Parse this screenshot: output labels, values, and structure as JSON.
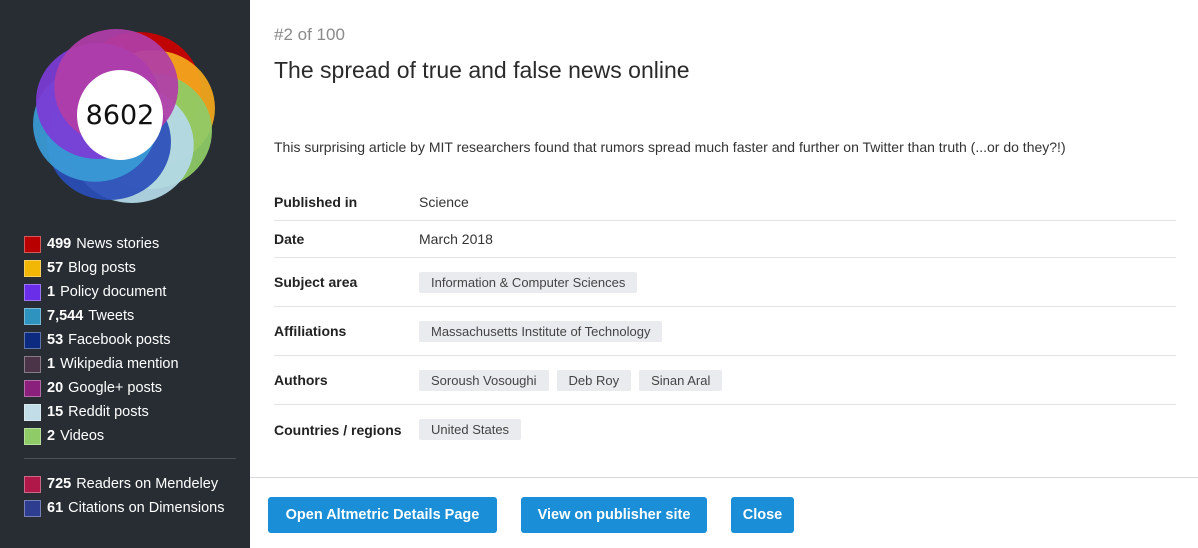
{
  "score": "8602",
  "donut_colors": [
    "#cc0000",
    "#f4a81c",
    "#8fcb67",
    "#b5d9e8",
    "#2a4db8",
    "#3a9bd6",
    "#7c3bd6",
    "#b03da8"
  ],
  "legend": {
    "items": [
      {
        "count": "499",
        "label": "News stories",
        "color": "#b80000"
      },
      {
        "count": "57",
        "label": "Blog posts",
        "color": "#f2b705"
      },
      {
        "count": "1",
        "label": "Policy document",
        "color": "#6a2ee8"
      },
      {
        "count": "7,544",
        "label": "Tweets",
        "color": "#2f93bf"
      },
      {
        "count": "53",
        "label": "Facebook posts",
        "color": "#0b2a80"
      },
      {
        "count": "1",
        "label": "Wikipedia mention",
        "color": "#4b3448"
      },
      {
        "count": "20",
        "label": "Google+ posts",
        "color": "#8a1f7c"
      },
      {
        "count": "15",
        "label": "Reddit posts",
        "color": "#c3dde8"
      },
      {
        "count": "2",
        "label": "Videos",
        "color": "#8fcb67"
      }
    ],
    "extra": [
      {
        "count": "725",
        "label": "Readers on Mendeley",
        "color": "#b0184a"
      },
      {
        "count": "61",
        "label": "Citations on Dimensions",
        "color": "#2e3d8f"
      }
    ]
  },
  "main": {
    "rank": "#2 of 100",
    "title": "The spread of true and false news online",
    "summary": "This surprising article by MIT researchers found that rumors spread much faster and further on Twitter than truth (...or do they?!)",
    "details": {
      "published_label": "Published in",
      "published_value": "Science",
      "date_label": "Date",
      "date_value": "March 2018",
      "subject_label": "Subject area",
      "subject_tags": [
        "Information & Computer Sciences"
      ],
      "affiliations_label": "Affiliations",
      "affiliation_tags": [
        "Massachusetts Institute of Technology"
      ],
      "authors_label": "Authors",
      "author_tags": [
        "Soroush Vosoughi",
        "Deb Roy",
        "Sinan Aral"
      ],
      "countries_label": "Countries / regions",
      "country_tags": [
        "United States"
      ]
    }
  },
  "footer": {
    "open_details": "Open Altmetric Details Page",
    "publisher": "View on publisher site",
    "close": "Close"
  }
}
